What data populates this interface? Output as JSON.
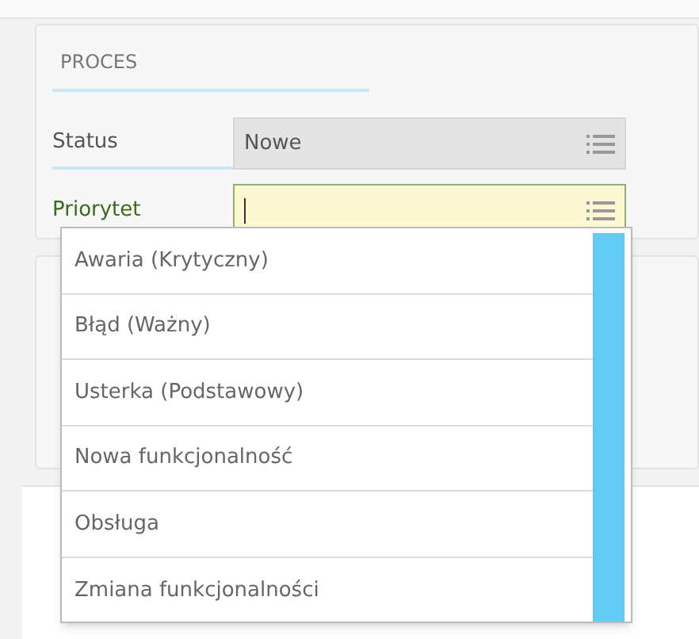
{
  "section": {
    "title": "PROCES"
  },
  "fields": [
    {
      "label": "Status",
      "value": "Nowe",
      "disabled": true,
      "focused": false
    },
    {
      "label": "Priorytet",
      "disabled": false,
      "focused": true
    }
  ],
  "dropdown": {
    "options": [
      {
        "label": "Awaria (Krytyczny)"
      },
      {
        "label": "Błąd (Ważny)"
      },
      {
        "label": "Usterka (Podstawowy)"
      },
      {
        "label": "Nowa funkcjonalność"
      },
      {
        "label": "Obsługa"
      },
      {
        "label": "Zmiana funkcjonalności"
      }
    ]
  }
}
